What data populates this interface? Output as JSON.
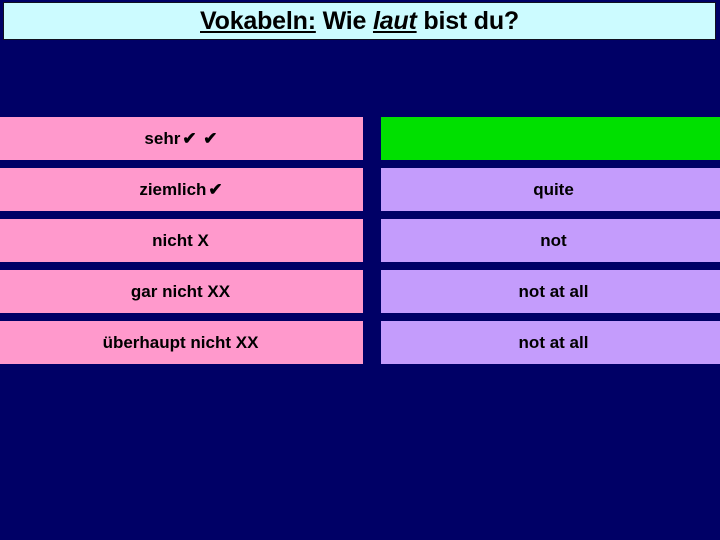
{
  "slide": {
    "background_color": "#000066",
    "title": {
      "full_text": "Vokabeln: Wie laut bist du?",
      "part_underlined": "Vokabeln:",
      "part_plain_1": "Wie",
      "part_italic_underlined": "laut",
      "part_plain_2": "bist du?",
      "background_color": "#CCFBFF",
      "text_color": "#000000"
    },
    "table": {
      "column_colors": {
        "german": "#FF99CC",
        "english": "#C49CFC",
        "highlight": "#00E000"
      },
      "rows": [
        {
          "german": "sehr",
          "marks": "✔ ✔",
          "english": "",
          "english_highlighted": true
        },
        {
          "german": "ziemlich",
          "marks": "✔",
          "english": "quite",
          "english_highlighted": false
        },
        {
          "german": "nicht X",
          "marks": "",
          "english": "not",
          "english_highlighted": false
        },
        {
          "german": "gar nicht XX",
          "marks": "",
          "english": "not at all",
          "english_highlighted": false
        },
        {
          "german": "überhaupt nicht XX",
          "marks": "",
          "english": "not at all",
          "english_highlighted": false
        }
      ]
    }
  }
}
